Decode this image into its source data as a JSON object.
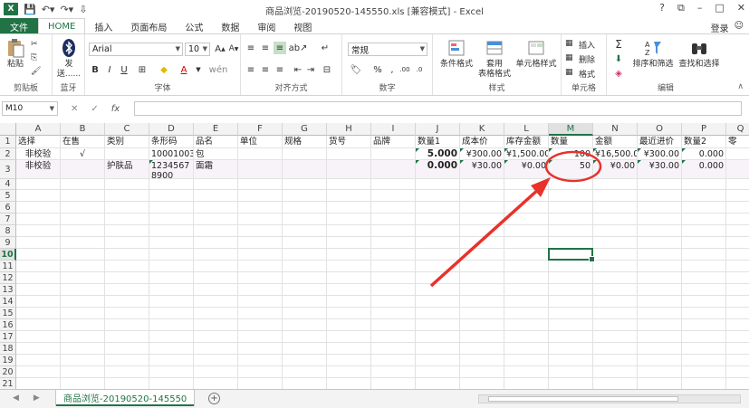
{
  "window": {
    "title": "商品浏览-20190520-145550.xls  [兼容模式] - Excel",
    "controls": [
      "?",
      "⧉",
      "–",
      "□",
      "✕"
    ]
  },
  "tabs": [
    "文件",
    "HOME",
    "插入",
    "页面布局",
    "公式",
    "数据",
    "审阅",
    "视图"
  ],
  "login": "登录",
  "ribbon": {
    "clipboard": {
      "paste": "粘贴",
      "label": "剪贴板"
    },
    "bluetooth": {
      "send": "发送......",
      "label": "蓝牙"
    },
    "font": {
      "name": "Arial",
      "size": "10",
      "label": "字体",
      "bold": "B",
      "italic": "I",
      "underline": "U"
    },
    "alignment": {
      "label": "对齐方式"
    },
    "number": {
      "format": "常规",
      "label": "数字",
      "percent": "%"
    },
    "styles": {
      "cond": "条件格式",
      "table": "套用\n表格格式",
      "cell": "单元格样式",
      "label": "样式"
    },
    "cells": {
      "insert": "插入",
      "delete": "删除",
      "format": "格式",
      "label": "单元格"
    },
    "editing": {
      "sort": "排序和筛选",
      "find": "查找和选择",
      "label": "编辑"
    }
  },
  "formula_bar": {
    "name_box": "M10",
    "fx": "fx",
    "content": ""
  },
  "columns": [
    "A",
    "B",
    "C",
    "D",
    "E",
    "F",
    "G",
    "H",
    "I",
    "J",
    "K",
    "L",
    "M",
    "N",
    "O",
    "P",
    "Q"
  ],
  "selected_column": "M",
  "rows": [
    "1",
    "2",
    "3",
    "4",
    "5",
    "6",
    "7",
    "8",
    "9",
    "10",
    "11",
    "12",
    "13",
    "14",
    "15",
    "16",
    "17",
    "18",
    "19",
    "20",
    "21"
  ],
  "selected_row": "10",
  "header_row": [
    "选择",
    "在售",
    "类别",
    "条形码",
    "品名",
    "单位",
    "规格",
    "货号",
    "品牌",
    "数量1",
    "成本价",
    "库存金额",
    "数量",
    "金额",
    "最近进价",
    "数量2",
    "零"
  ],
  "row2": [
    "非校验",
    "√",
    "",
    "10001003",
    "包",
    "",
    "",
    "",
    "",
    "5.000",
    "¥300.00",
    "¥1,500.00",
    "100",
    "¥16,500.00",
    "¥300.00",
    "0.000",
    ""
  ],
  "row3": [
    "非校验",
    "",
    "护肤品",
    "12345678900",
    "面霜",
    "",
    "",
    "",
    "",
    "0.000",
    "¥30.00",
    "¥0.00",
    "50",
    "¥0.00",
    "¥30.00",
    "0.000",
    ""
  ],
  "sheet": {
    "tab": "商品浏览-20190520-145550",
    "add": "+"
  },
  "colors": {
    "accent": "#217346",
    "annotation": "#e8322b"
  }
}
